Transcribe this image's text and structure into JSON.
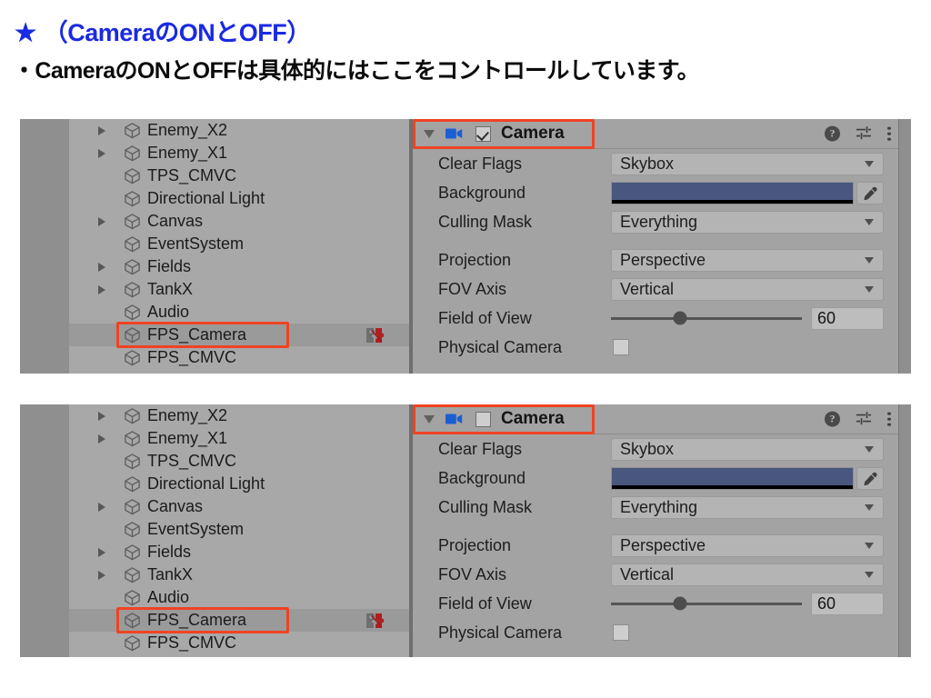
{
  "slide": {
    "star_glyph": "★",
    "heading": "（CameraのONとOFF）",
    "subheading": "・CameraのONとOFFは具体的にはここをコントロールしています。",
    "heading_color": "#1a2ae0",
    "subheading_color": "#0b0b0b",
    "highlight_color": "#ef4323"
  },
  "hierarchy": {
    "items": [
      {
        "label": "Enemy_X2",
        "expandable": true,
        "indent": 0
      },
      {
        "label": "Enemy_X1",
        "expandable": true,
        "indent": 0
      },
      {
        "label": "TPS_CMVC",
        "expandable": false,
        "indent": 0
      },
      {
        "label": "Directional Light",
        "expandable": false,
        "indent": 0
      },
      {
        "label": "Canvas",
        "expandable": true,
        "indent": 0
      },
      {
        "label": "EventSystem",
        "expandable": false,
        "indent": 0
      },
      {
        "label": "Fields",
        "expandable": true,
        "indent": 0
      },
      {
        "label": "TankX",
        "expandable": true,
        "indent": 0
      },
      {
        "label": "Audio",
        "expandable": false,
        "indent": 0
      },
      {
        "label": "FPS_Camera",
        "expandable": false,
        "indent": 0,
        "selected": true,
        "highlighted": true,
        "has_script_icon": true
      },
      {
        "label": "FPS_CMVC",
        "expandable": false,
        "indent": 0
      }
    ],
    "icons": {
      "cube": "cube-icon",
      "twisty": "chevron-right-icon",
      "script": "script-gear-icon"
    }
  },
  "inspector": {
    "component_title": "Camera",
    "component_icon": "camera-icon",
    "foldout_icon": "chevron-down-icon",
    "header_icons": [
      {
        "name": "help-icon",
        "glyph": "?"
      },
      {
        "name": "preset-icon",
        "glyph": ""
      },
      {
        "name": "more-menu-icon",
        "glyph": ""
      }
    ],
    "enabled_top": true,
    "enabled_bottom": false,
    "properties": [
      {
        "label": "Clear Flags",
        "type": "dropdown",
        "value": "Skybox"
      },
      {
        "label": "Background",
        "type": "color",
        "value": "#49577f"
      },
      {
        "label": "Culling Mask",
        "type": "dropdown",
        "value": "Everything"
      },
      {
        "label": "Projection",
        "type": "dropdown",
        "value": "Perspective",
        "gap_before": true
      },
      {
        "label": "FOV Axis",
        "type": "dropdown",
        "value": "Vertical"
      },
      {
        "label": "Field of View",
        "type": "slider",
        "value": "60",
        "slider_percent": 36
      },
      {
        "label": "Physical Camera",
        "type": "bool",
        "value": false
      }
    ]
  },
  "panels": [
    {
      "id": "top",
      "caption": "camera-enabled-state"
    },
    {
      "id": "bottom",
      "caption": "camera-disabled-state"
    }
  ]
}
